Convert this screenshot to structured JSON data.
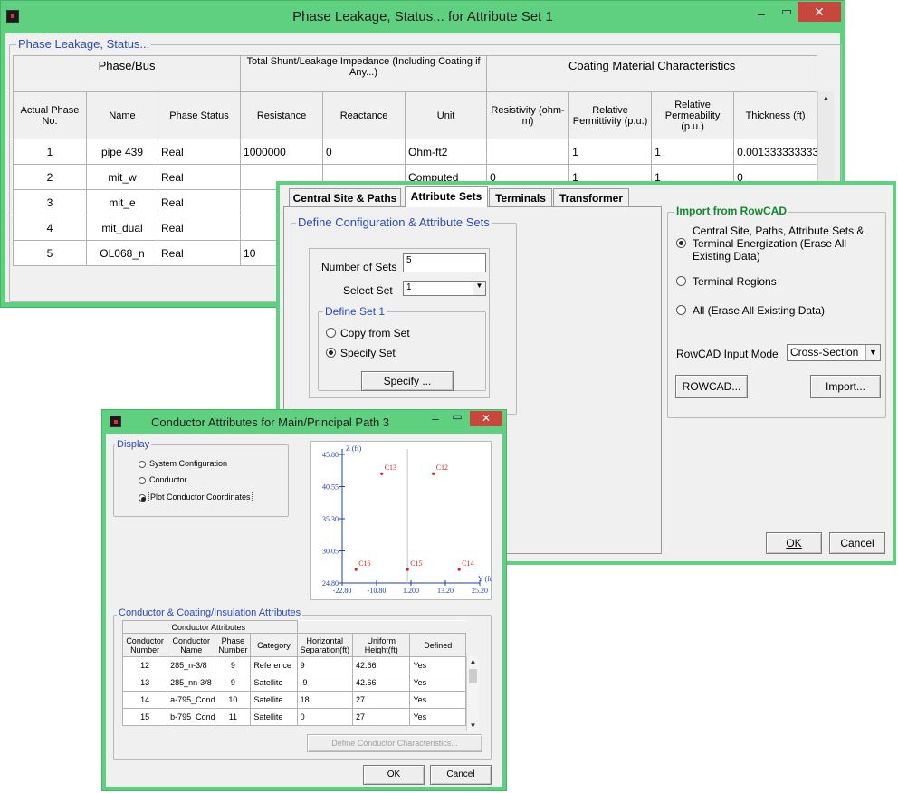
{
  "phase_window": {
    "title": "Phase Leakage, Status... for Attribute Set 1",
    "group_label": "Phase Leakage, Status...",
    "header_groups": [
      "Phase/Bus",
      "Total Shunt/Leakage Impedance (Including Coating if Any...)",
      "Coating Material Characteristics"
    ],
    "columns": [
      "Actual Phase No.",
      "Name",
      "Phase Status",
      "Resistance",
      "Reactance",
      "Unit",
      "Resistivity (ohm-m)",
      "Relative Permittivity (p.u.)",
      "Relative Permeability (p.u.)",
      "Thickness (ft)"
    ],
    "rows": [
      [
        "1",
        "pipe 439",
        "Real",
        "1000000",
        "0",
        "Ohm-ft2",
        "",
        "1",
        "1",
        "0.00133333333333"
      ],
      [
        "2",
        "mit_w",
        "Real",
        "",
        "",
        "Computed",
        "0",
        "1",
        "1",
        "0"
      ],
      [
        "3",
        "mit_e",
        "Real",
        "",
        "",
        "",
        "",
        "",
        "",
        ""
      ],
      [
        "4",
        "mit_dual",
        "Real",
        "",
        "",
        "",
        "",
        "",
        "",
        ""
      ],
      [
        "5",
        "OL068_n",
        "Real",
        "10",
        "",
        "",
        "",
        "",
        "",
        ""
      ]
    ]
  },
  "sets_window": {
    "tabs": [
      "Central Site & Paths",
      "Attribute Sets",
      "Terminals",
      "Transformer"
    ],
    "active_tab": "Attribute Sets",
    "define_group": "Define Configuration & Attribute Sets",
    "number_of_sets_label": "Number of Sets",
    "number_of_sets_value": "5",
    "select_set_label": "Select Set",
    "select_set_value": "1",
    "define_set_group": "Define Set 1",
    "copy_from_set": "Copy from Set",
    "specify_set": "Specify Set",
    "specify_button": "Specify ...",
    "import_group": "Import from RowCAD",
    "import_options": [
      "Central Site, Paths, Attribute Sets & Terminal Energization (Erase All Existing Data)",
      "Terminal Regions",
      "All (Erase All Existing Data)"
    ],
    "input_mode_label": "RowCAD Input Mode",
    "input_mode_value": "Cross-Section",
    "rowcad_button": "ROWCAD...",
    "import_button": "Import...",
    "ok_button": "OK",
    "cancel_button": "Cancel"
  },
  "conductor_window": {
    "title": "Conductor Attributes for Main/Principal Path 3",
    "display_group": "Display",
    "display_options": [
      "System Configuration",
      "Conductor",
      "Plot Conductor Coordinates"
    ],
    "selected_display": 2,
    "plot": {
      "z_label": "Z (ft)",
      "y_label": "Y (ft)",
      "z_ticks": [
        "45.80",
        "40.55",
        "35.30",
        "30.05",
        "24.80"
      ],
      "y_ticks": [
        "-22.80",
        "-10.80",
        "1.200",
        "13.20",
        "25.20"
      ],
      "point_color": "#e02020",
      "axis_color": "#1f3cc6"
    },
    "chart_data": {
      "type": "scatter",
      "title": "",
      "xlabel": "Y (ft)",
      "ylabel": "Z (ft)",
      "xlim": [
        -22.8,
        25.2
      ],
      "ylim": [
        24.8,
        45.8
      ],
      "points": [
        {
          "label": "C13",
          "x": -9,
          "y": 42.66
        },
        {
          "label": "C12",
          "x": 9,
          "y": 42.66
        },
        {
          "label": "C16",
          "x": -18,
          "y": 27
        },
        {
          "label": "C15",
          "x": 0,
          "y": 27
        },
        {
          "label": "C14",
          "x": 18,
          "y": 27
        }
      ]
    },
    "attr_group": "Conductor & Coating/Insulation Attributes",
    "attr_header_group": "Conductor Attributes",
    "attr_columns": [
      "Conductor Number",
      "Conductor Name",
      "Phase Number",
      "Category",
      "Horizontal Separation(ft)",
      "Uniform Height(ft)",
      "Defined"
    ],
    "attr_rows": [
      [
        "12",
        "285_n-3/8",
        "9",
        "Reference",
        "9",
        "42.66",
        "Yes"
      ],
      [
        "13",
        "285_nn-3/8",
        "9",
        "Satellite",
        "-9",
        "42.66",
        "Yes"
      ],
      [
        "14",
        "a-795_Cond",
        "10",
        "Satellite",
        "18",
        "27",
        "Yes"
      ],
      [
        "15",
        "b-795_Cond",
        "11",
        "Satellite",
        "0",
        "27",
        "Yes"
      ]
    ],
    "define_button": "Define Conductor Characteristics...",
    "ok_button": "OK",
    "cancel_button": "Cancel"
  }
}
